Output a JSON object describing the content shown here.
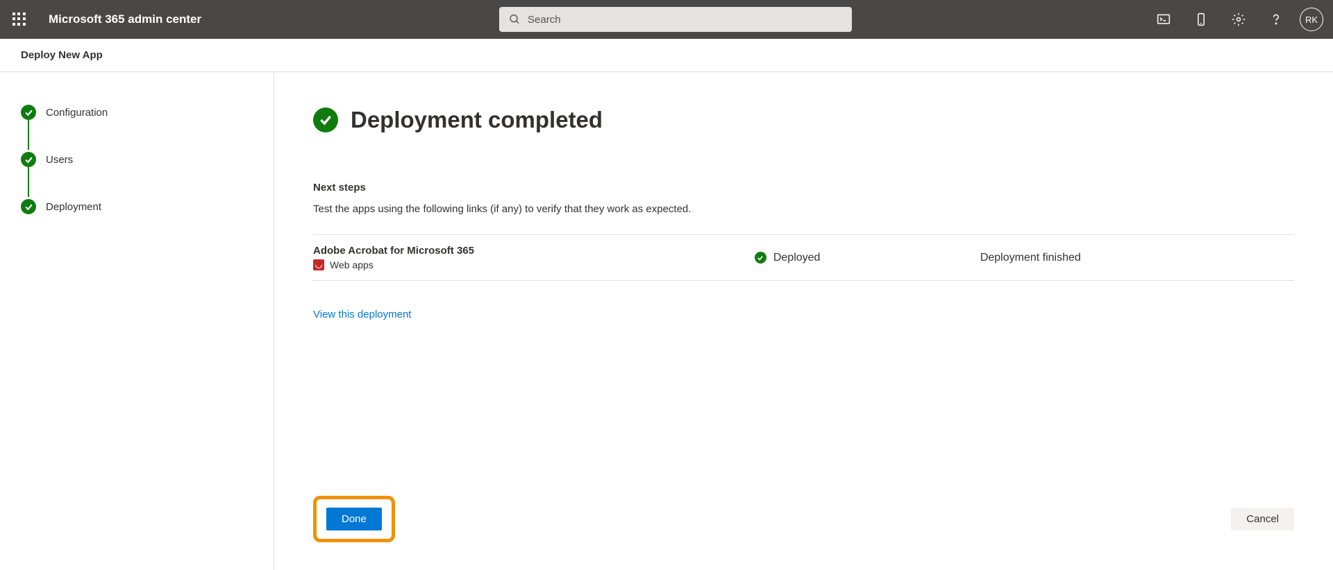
{
  "header": {
    "brand": "Microsoft 365 admin center",
    "search_placeholder": "Search",
    "avatar_initials": "RK"
  },
  "subheader": {
    "title": "Deploy New App"
  },
  "steps": [
    {
      "label": "Configuration"
    },
    {
      "label": "Users"
    },
    {
      "label": "Deployment"
    }
  ],
  "main": {
    "title": "Deployment completed",
    "next_steps_heading": "Next steps",
    "next_steps_text": "Test the apps using the following links (if any) to verify that they work as expected.",
    "app": {
      "name": "Adobe Acrobat for Microsoft 365",
      "subtype": "Web apps",
      "status": "Deployed",
      "detail": "Deployment finished"
    },
    "view_link": "View this deployment",
    "done_label": "Done",
    "cancel_label": "Cancel"
  }
}
